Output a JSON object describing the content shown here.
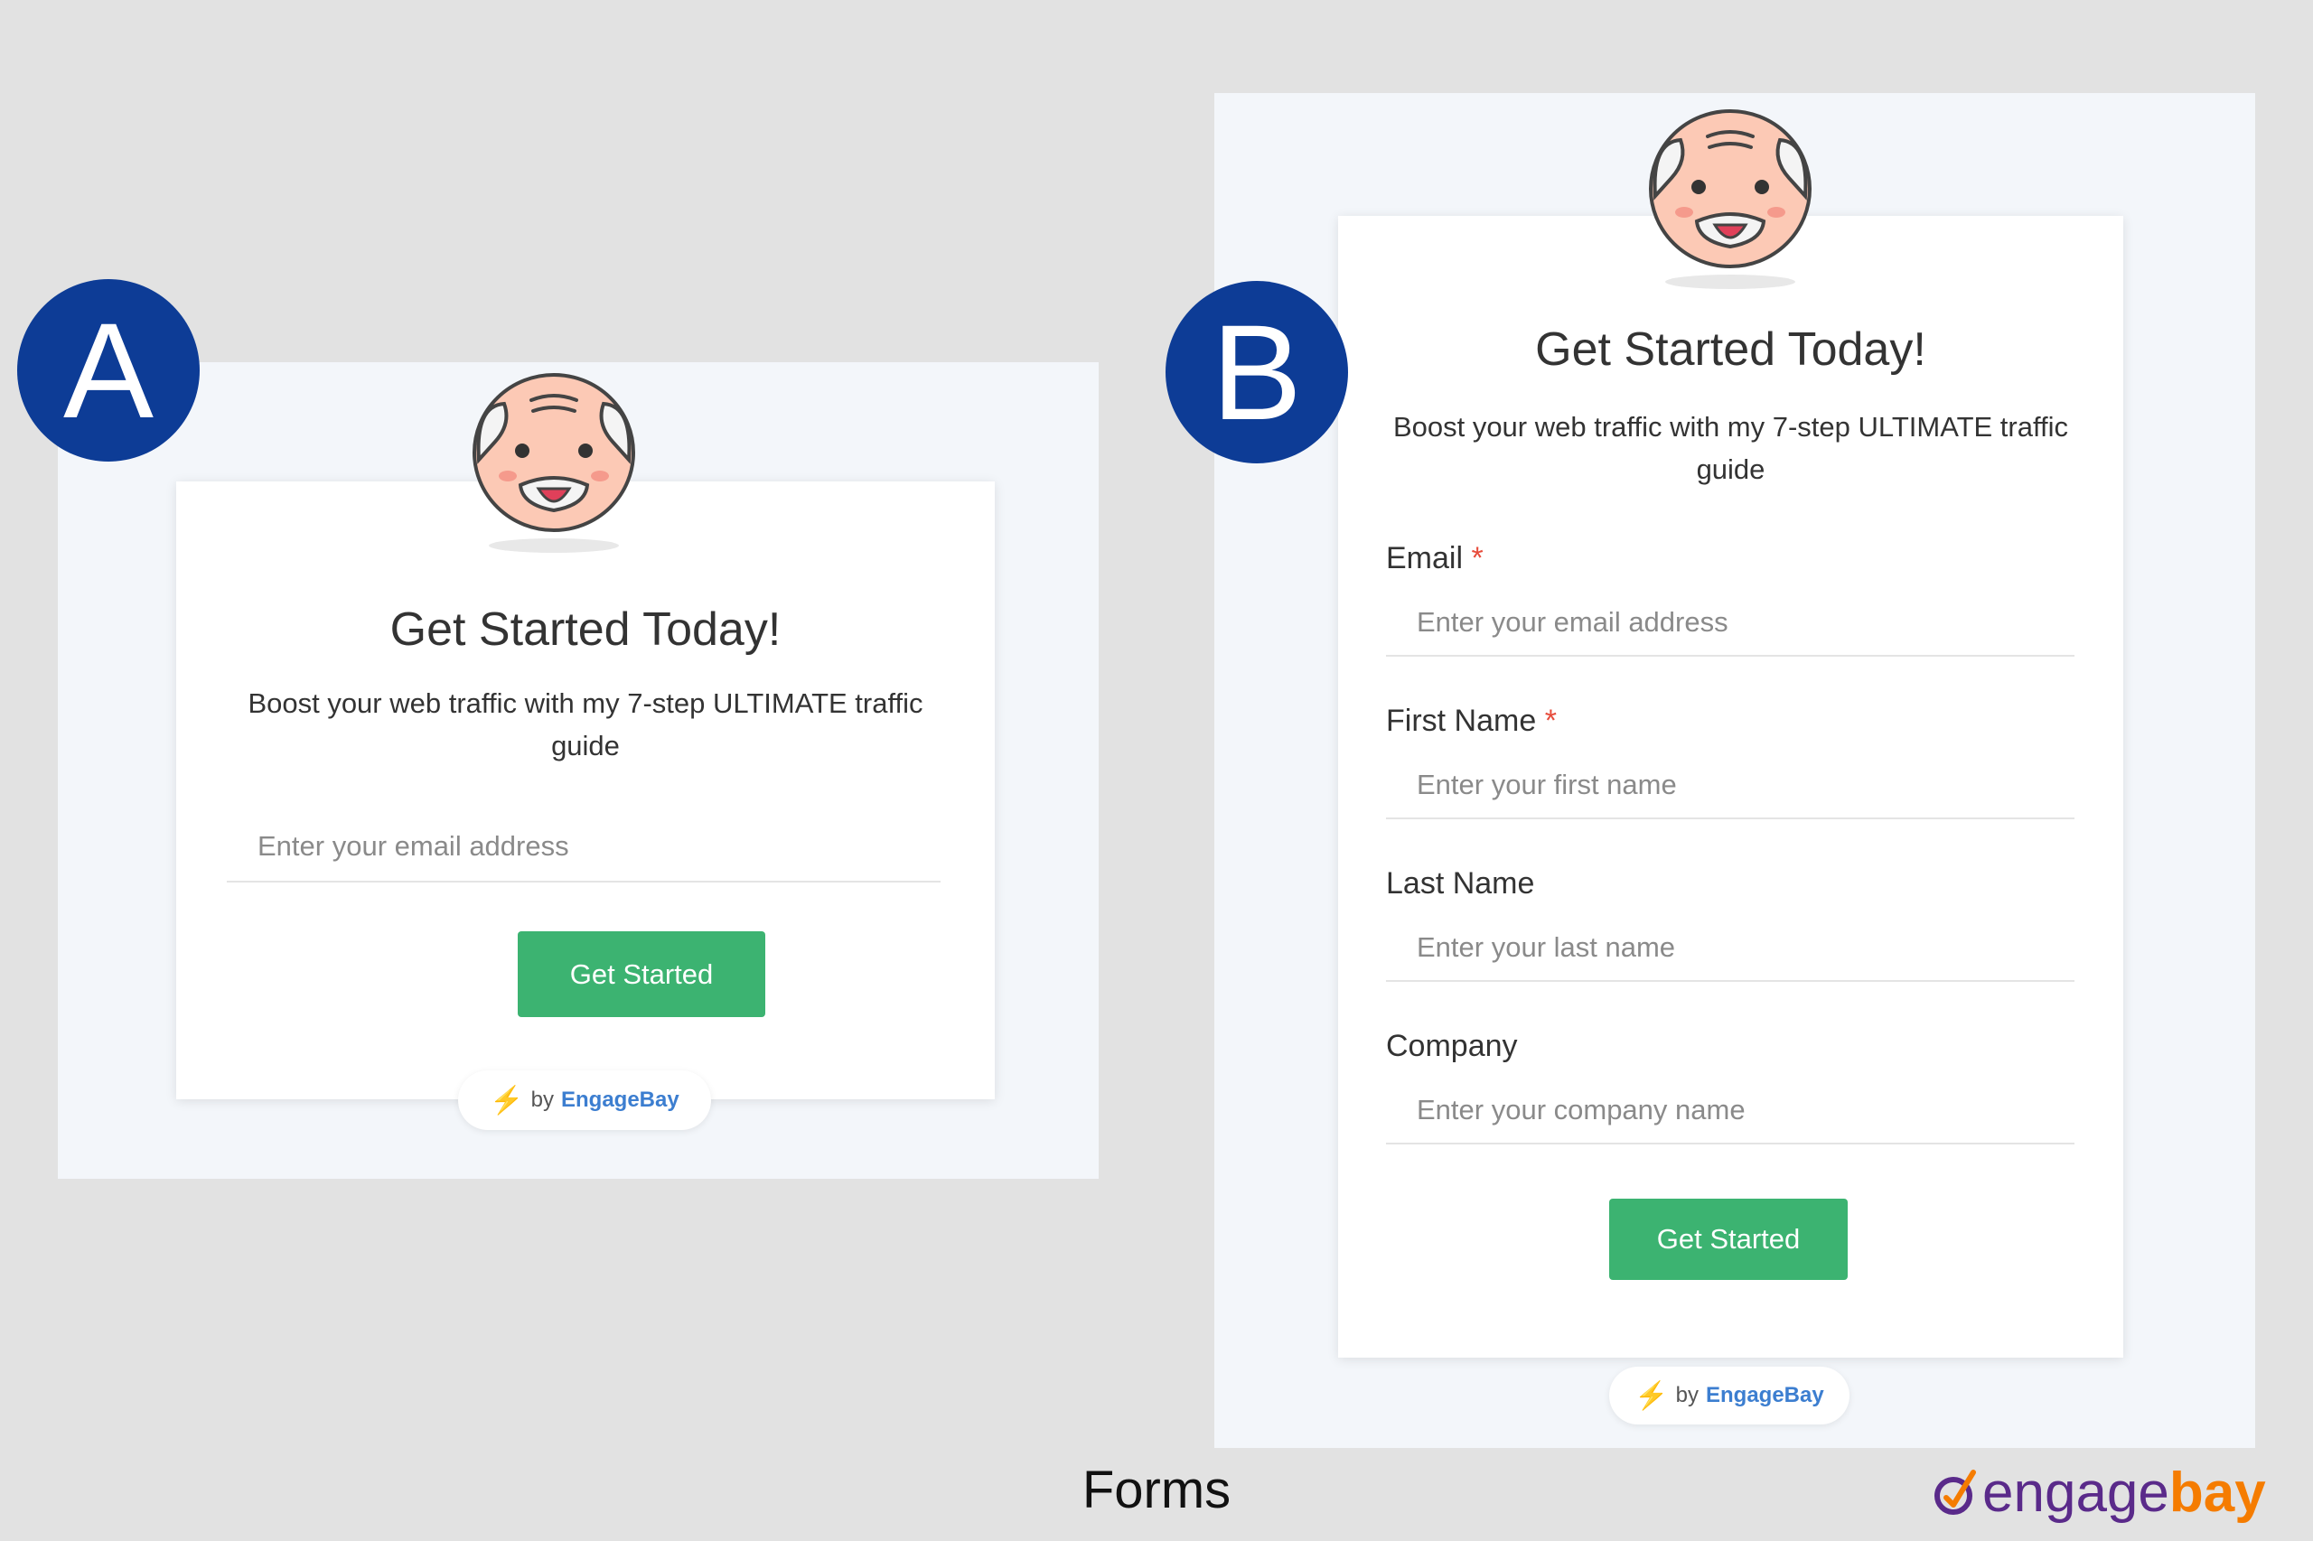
{
  "variant_a": {
    "badge": "A",
    "headline": "Get Started Today!",
    "subtitle": "Boost your web traffic with my 7-step ULTIMATE traffic guide",
    "email_placeholder": "Enter your email address",
    "button_label": "Get Started",
    "branding": {
      "prefix": "by",
      "name": "EngageBay"
    }
  },
  "variant_b": {
    "badge": "B",
    "headline": "Get Started Today!",
    "subtitle": "Boost your web traffic with my 7-step ULTIMATE traffic guide",
    "fields": [
      {
        "label": "Email",
        "required": "*",
        "placeholder": "Enter your email address"
      },
      {
        "label": "First Name",
        "required": "*",
        "placeholder": "Enter your first name"
      },
      {
        "label": "Last Name",
        "required": "",
        "placeholder": "Enter your last name"
      },
      {
        "label": "Company",
        "required": "",
        "placeholder": "Enter your company name"
      }
    ],
    "button_label": "Get Started",
    "branding": {
      "prefix": "by",
      "name": "EngageBay"
    }
  },
  "caption": "Forms",
  "logo": {
    "part1": "engage",
    "part2": "bay"
  },
  "colors": {
    "badge": "#0d3c96",
    "button": "#3cb371",
    "brand_link": "#3c7ed0",
    "required_mark": "#e74c3c",
    "logo_primary": "#5a2a8a",
    "logo_accent": "#f57c00"
  },
  "icons": [
    "old-man-avatar-icon",
    "lightning-bolt-icon",
    "engagebay-logo-mark-icon"
  ]
}
